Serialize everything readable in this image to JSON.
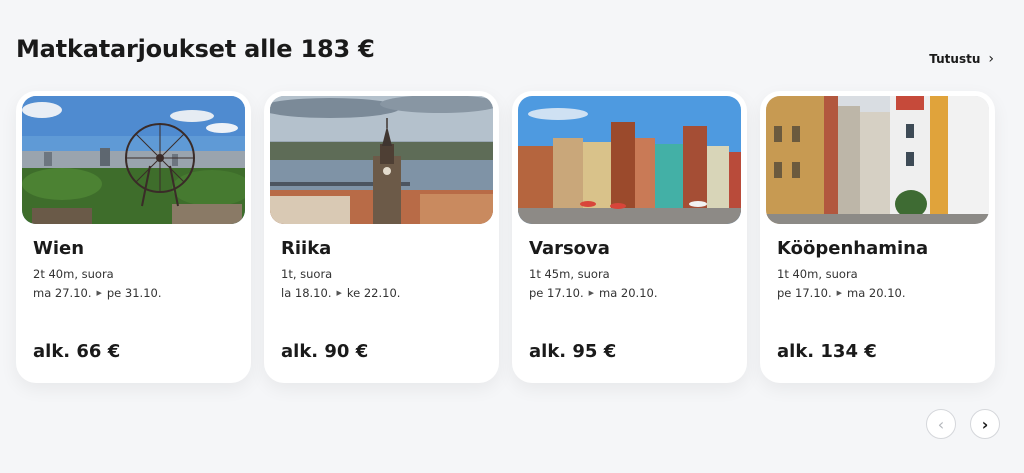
{
  "heading": "Matkatarjoukset alle 183 €",
  "explore_label": "Tutustu",
  "cards": [
    {
      "city": "Wien",
      "duration": "2t 40m, suora",
      "date_out": "ma 27.10.",
      "date_back": "pe 31.10.",
      "price": "alk. 66 €"
    },
    {
      "city": "Riika",
      "duration": "1t, suora",
      "date_out": "la 18.10.",
      "date_back": "ke 22.10.",
      "price": "alk. 90 €"
    },
    {
      "city": "Varsova",
      "duration": "1t 45m, suora",
      "date_out": "pe 17.10.",
      "date_back": "ma 20.10.",
      "price": "alk. 95 €"
    },
    {
      "city": "Kööpenhamina",
      "duration": "1t 40m, suora",
      "date_out": "pe 17.10.",
      "date_back": "ma 20.10.",
      "price": "alk. 134 €"
    }
  ],
  "icons": {
    "explore": "chevron-right-icon",
    "date_arrow": "triangle-right-icon",
    "prev": "chevron-left-icon",
    "next": "chevron-right-icon"
  }
}
